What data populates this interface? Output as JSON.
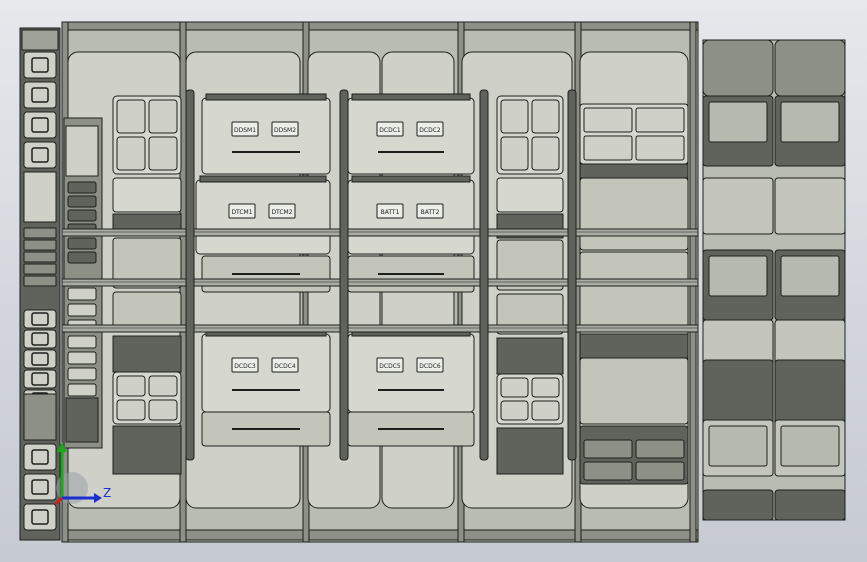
{
  "viewport": {
    "name": "3D model graphics area",
    "background_top": "#e6e8ec",
    "background_bottom": "#c6cad1"
  },
  "model": {
    "colors": {
      "frame": "#b9bcb2",
      "panel": "#cfd0c8",
      "module": "#c3c5bb",
      "module_light": "#d6d7cf",
      "dark": "#5f635b",
      "mid": "#8d9086",
      "edge": "#1d1f1c"
    },
    "central_labels": [
      [
        "DDSM1",
        "DDSM2"
      ],
      [
        "DCDC1",
        "DCDC2"
      ],
      [
        "DTCM1",
        "DTCM2"
      ],
      [
        "BATT1",
        "BATT2"
      ],
      [
        "DCDC3",
        "DCDC4"
      ],
      [
        "DCDC5",
        "DCDC6"
      ]
    ]
  },
  "triad": {
    "x_axis_label": "Z",
    "y_axis_color": "#1aa81a",
    "z_axis_color": "#1c2fd0",
    "x_axis_color": "#d21b1b"
  }
}
